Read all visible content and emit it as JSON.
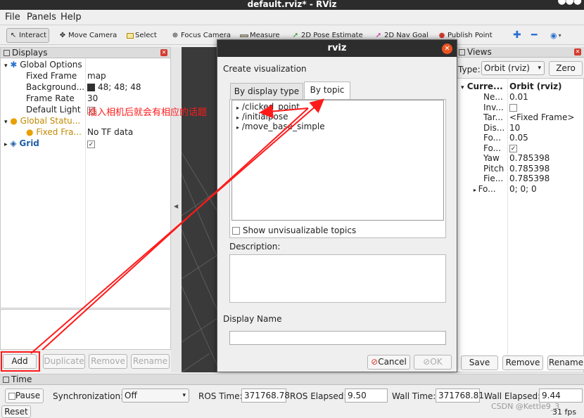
{
  "window": {
    "title": "default.rviz* - RViz"
  },
  "menu": {
    "file": "File",
    "panels": "Panels",
    "help": "Help"
  },
  "toolbar": {
    "interact": "Interact",
    "move_camera": "Move Camera",
    "select": "Select",
    "focus_camera": "Focus Camera",
    "measure": "Measure",
    "pose_estimate": "2D Pose Estimate",
    "nav_goal": "2D Nav Goal",
    "publish_point": "Publish Point"
  },
  "displays": {
    "title": "Displays",
    "global_options": "Global Options",
    "fixed_frame_label": "Fixed Frame",
    "fixed_frame_value": "map",
    "background_label": "Background...",
    "background_value": "48; 48; 48",
    "frame_rate_label": "Frame Rate",
    "frame_rate_value": "30",
    "default_light_label": "Default Light",
    "global_status": "Global Statu...",
    "fixed_frame_status_label": "Fixed Fra...",
    "fixed_frame_status_value": "No TF data",
    "grid": "Grid",
    "buttons": {
      "add": "Add",
      "duplicate": "Duplicate",
      "remove": "Remove",
      "rename": "Rename"
    }
  },
  "dialog": {
    "title": "rviz",
    "heading": "Create visualization",
    "tab_display_type": "By display type",
    "tab_topic": "By topic",
    "topics": [
      "/clicked_point",
      "/initialpose",
      "/move_base_simple"
    ],
    "show_unvisualizable": "Show unvisualizable topics",
    "description_label": "Description:",
    "display_name_label": "Display Name",
    "cancel": "Cancel",
    "ok": "OK"
  },
  "views": {
    "title": "Views",
    "type_label": "Type:",
    "type_value": "Orbit (rviz)",
    "zero": "Zero",
    "current_label": "Curre...",
    "current_value": "Orbit (rviz)",
    "props": [
      {
        "label": "Ne...",
        "value": "0.01"
      },
      {
        "label": "Inv...",
        "value": ""
      },
      {
        "label": "Tar...",
        "value": "<Fixed Frame>"
      },
      {
        "label": "Dis...",
        "value": "10"
      },
      {
        "label": "Fo...",
        "value": "0.05"
      },
      {
        "label": "Fo...",
        "value": ""
      },
      {
        "label": "Yaw",
        "value": "0.785398"
      },
      {
        "label": "Pitch",
        "value": "0.785398"
      },
      {
        "label": "Fie...",
        "value": "0.785398"
      },
      {
        "label": "Fo...",
        "value": "0; 0; 0"
      }
    ],
    "save": "Save",
    "remove": "Remove",
    "rename": "Rename"
  },
  "time": {
    "title": "Time",
    "pause": "Pause",
    "sync_label": "Synchronization:",
    "sync_value": "Off",
    "ros_time_label": "ROS Time:",
    "ros_time_value": "371768.78",
    "ros_elapsed_label": "ROS Elapsed:",
    "ros_elapsed_value": "9.50",
    "wall_time_label": "Wall Time:",
    "wall_time_value": "371768.81",
    "wall_elapsed_label": "Wall Elapsed:",
    "wall_elapsed_value": "9.44",
    "reset": "Reset",
    "fps": "31 fps"
  },
  "annotation": {
    "text": "插入相机后就会有相应的话题"
  },
  "watermark": "CSDN @Kettle9_3",
  "colors": {
    "highlight_red": "#ff1a1a",
    "dialog_close": "#e95420",
    "grid_blue": "#1f5fa8",
    "warning_orange": "#e8a000"
  }
}
